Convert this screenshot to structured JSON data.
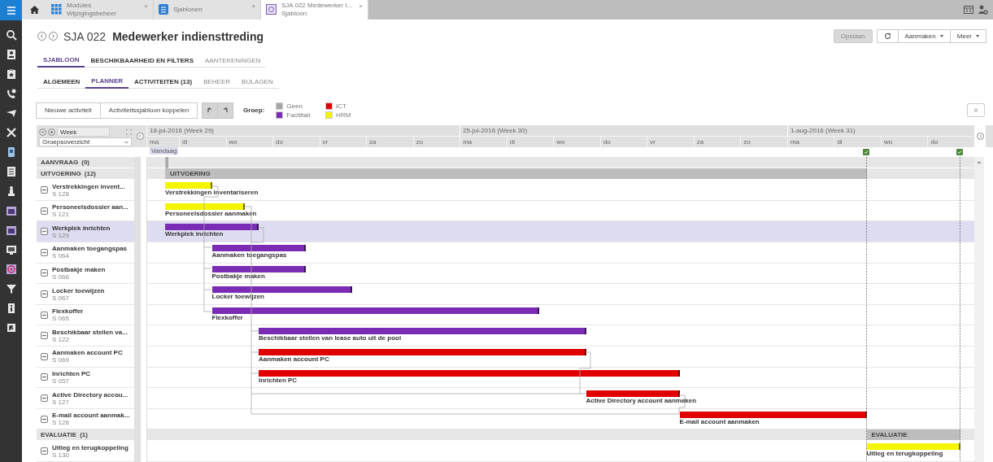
{
  "tab_bar": {
    "tabs": [
      {
        "title": "Modules",
        "subtitle": "Wijzigingsbeheer",
        "kind": "grid",
        "selected": false,
        "close": "×"
      },
      {
        "title": "Sjablonen",
        "kind": "list",
        "selected": false,
        "close": "×"
      },
      {
        "title": "SJA 022 Medewerker I...",
        "subtitle": "Sjabloon",
        "kind": "template",
        "selected": true,
        "close": "×"
      }
    ]
  },
  "header": {
    "code": "SJA 022",
    "title": "Medewerker indiensttreding"
  },
  "actions": [
    {
      "label": "Opslaan",
      "kind": "plain",
      "disabled": true
    },
    {
      "kind": "refresh",
      "disabled": false
    },
    {
      "label": "Aanmaken",
      "kind": "menu",
      "disabled": false
    },
    {
      "label": "Meer",
      "kind": "menu",
      "disabled": false
    }
  ],
  "primary_tabs": [
    {
      "label": "SJABLOON",
      "selected": true
    },
    {
      "label": "BESCHIKBAARHEID EN FILTERS",
      "selected": false
    },
    {
      "label": "AANTEKENINGEN",
      "selected": false
    }
  ],
  "secondary_tabs": [
    {
      "label": "ALGEMEEN",
      "selected": false
    },
    {
      "label": "PLANNER",
      "selected": true
    },
    {
      "label": "ACTIVITEITEN (13)",
      "selected": false
    },
    {
      "label": "BEHEER",
      "selected": false
    },
    {
      "label": "BIJLAGEN",
      "selected": false
    }
  ],
  "toolbar": {
    "buttons": [
      "Nieuwe activiteit",
      "Activiteitssjabloon koppelen"
    ],
    "legend_label": "Groep:",
    "legend": [
      {
        "label": "Geen",
        "color": "#a6a6a6"
      },
      {
        "label": "Facilitair",
        "color": "#7b2cb5"
      },
      {
        "label": "ICT",
        "color": "#e00000"
      },
      {
        "label": "HRM",
        "color": "#f5f500"
      }
    ]
  },
  "gantt": {
    "zoom_field": "Week",
    "view_select": "Groepsoverzicht",
    "today_label": "Vandaag",
    "weeks": [
      "18-jul-2016 (Week 29)",
      "25-jul-2016 (Week 30)",
      "1-aug-2016 (Week 31)"
    ],
    "days": [
      "ma",
      "di",
      "wo",
      "do",
      "vr",
      "za",
      "zo",
      "ma",
      "di",
      "wo",
      "do",
      "vr",
      "za",
      "zo",
      "ma",
      "di",
      "wo",
      "do"
    ],
    "groups": [
      {
        "label": "AANVRAAG",
        "count": "(0)"
      },
      {
        "label": "UITVOERING",
        "count": "(12)",
        "band_label": "UITVOERING",
        "activities": [
          {
            "short_name": "Verstrekkingen invent...",
            "code": "S 128",
            "name": "Verstrekkingen inventariseren",
            "color": "#f5f500",
            "selected": false
          },
          {
            "short_name": "Personeelsdossier aan...",
            "code": "S 121",
            "name": "Personeelsdossier aanmaken",
            "color": "#f5f500",
            "selected": false
          },
          {
            "short_name": "Werkplek inrichten",
            "code": "S 129",
            "name": "Werkplek inrichten",
            "color": "#7b2cb5",
            "selected": true
          },
          {
            "short_name": "Aanmaken toegangspas",
            "code": "S 064",
            "name": "Aanmaken toegangspas",
            "color": "#7b2cb5",
            "selected": false
          },
          {
            "short_name": "Postbakje maken",
            "code": "S 066",
            "name": "Postbakje maken",
            "color": "#7b2cb5",
            "selected": false
          },
          {
            "short_name": "Locker toewijzen",
            "code": "S 067",
            "name": "Locker toewijzen",
            "color": "#7b2cb5",
            "selected": false
          },
          {
            "short_name": "Flexkoffer",
            "code": "S 065",
            "name": "Flexkoffer",
            "color": "#7b2cb5",
            "selected": false
          },
          {
            "short_name": "Beschikbaar stellen va...",
            "code": "S 122",
            "name": "Beschikbaar stellen van lease auto uit de pool",
            "color": "#7b2cb5",
            "selected": false
          },
          {
            "short_name": "Aanmaken account PC",
            "code": "S 069",
            "name": "Aanmaken account PC",
            "color": "#e00000",
            "selected": false
          },
          {
            "short_name": "Inrichten PC",
            "code": "S 057",
            "name": "Inrichten PC",
            "color": "#e00000",
            "selected": false
          },
          {
            "short_name": "Active Directory accou...",
            "code": "S 127",
            "name": "Active Directory account aanmaken",
            "color": "#e00000",
            "selected": false
          },
          {
            "short_name": "E-mail account aanmak...",
            "code": "S 126",
            "name": "E-mail account aanmaken",
            "color": "#e00000",
            "selected": false
          }
        ]
      },
      {
        "label": "EVALUATIE",
        "count": "(1)",
        "band_label": "EVALUATIE",
        "activities": [
          {
            "short_name": "Uitleg en terugkoppeling",
            "code": "S 130",
            "name": "Uitleg en terugkoppeling",
            "color": "#f5f500",
            "selected": false
          }
        ]
      }
    ]
  }
}
